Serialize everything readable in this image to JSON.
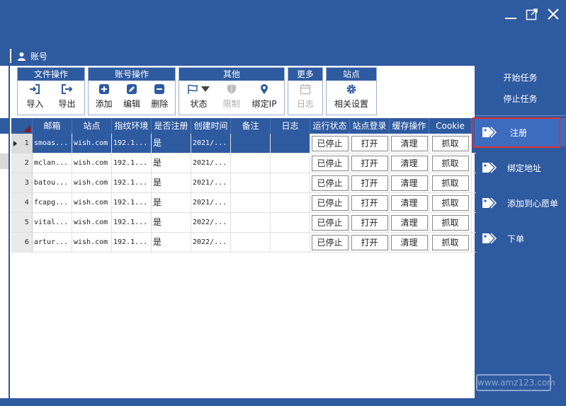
{
  "header": {
    "account_label": "账号"
  },
  "toolbar": {
    "groups": [
      {
        "title": "文件操作",
        "tools": [
          "导入",
          "导出"
        ]
      },
      {
        "title": "账号操作",
        "tools": [
          "添加",
          "编辑",
          "删除"
        ]
      },
      {
        "title": "其他",
        "tools": [
          "状态",
          "限制",
          "绑定IP"
        ]
      },
      {
        "title": "更多",
        "tools": [
          "日志"
        ]
      },
      {
        "title": "站点",
        "tools": [
          "相关设置"
        ]
      }
    ]
  },
  "grid": {
    "columns": [
      "邮箱",
      "站点",
      "指纹环境",
      "是否注册",
      "创建时间",
      "备注",
      "日志",
      "运行状态",
      "站点登录",
      "缓存操作",
      "Cookie"
    ],
    "rows": [
      {
        "num": "1",
        "email": "smoas...",
        "site": "wish.com",
        "fp": "192.1...",
        "reg": "是",
        "ct": "2021/...",
        "note": "",
        "log": "",
        "run": "已停止",
        "login": "打开",
        "cache": "清理",
        "cookie": "抓取"
      },
      {
        "num": "2",
        "email": "mclan...",
        "site": "wish.com",
        "fp": "192.1...",
        "reg": "是",
        "ct": "2021/...",
        "note": "",
        "log": "",
        "run": "已停止",
        "login": "打开",
        "cache": "清理",
        "cookie": "抓取"
      },
      {
        "num": "3",
        "email": "batou...",
        "site": "wish.com",
        "fp": "192.1...",
        "reg": "是",
        "ct": "2021/...",
        "note": "",
        "log": "",
        "run": "已停止",
        "login": "打开",
        "cache": "清理",
        "cookie": "抓取"
      },
      {
        "num": "4",
        "email": "fcapg...",
        "site": "wish.com",
        "fp": "192.1...",
        "reg": "是",
        "ct": "2021/...",
        "note": "",
        "log": "",
        "run": "已停止",
        "login": "打开",
        "cache": "清理",
        "cookie": "抓取"
      },
      {
        "num": "5",
        "email": "vital...",
        "site": "wish.com",
        "fp": "192.1...",
        "reg": "是",
        "ct": "2022/...",
        "note": "",
        "log": "",
        "run": "已停止",
        "login": "打开",
        "cache": "清理",
        "cookie": "抓取"
      },
      {
        "num": "6",
        "email": "artur...",
        "site": "wish.com",
        "fp": "192.1...",
        "reg": "是",
        "ct": "2022/...",
        "note": "",
        "log": "",
        "run": "已停止",
        "login": "打开",
        "cache": "清理",
        "cookie": "抓取"
      }
    ]
  },
  "sidebar": {
    "start_task": "开始任务",
    "stop_task": "停止任务",
    "items": [
      "注册",
      "绑定地址",
      "添加到心愿单",
      "下单"
    ]
  },
  "watermark": "www.amz123.com",
  "colors": {
    "primary": "#2e5aa0",
    "active_item": "#3d6cbf",
    "highlight": "#e03030"
  }
}
